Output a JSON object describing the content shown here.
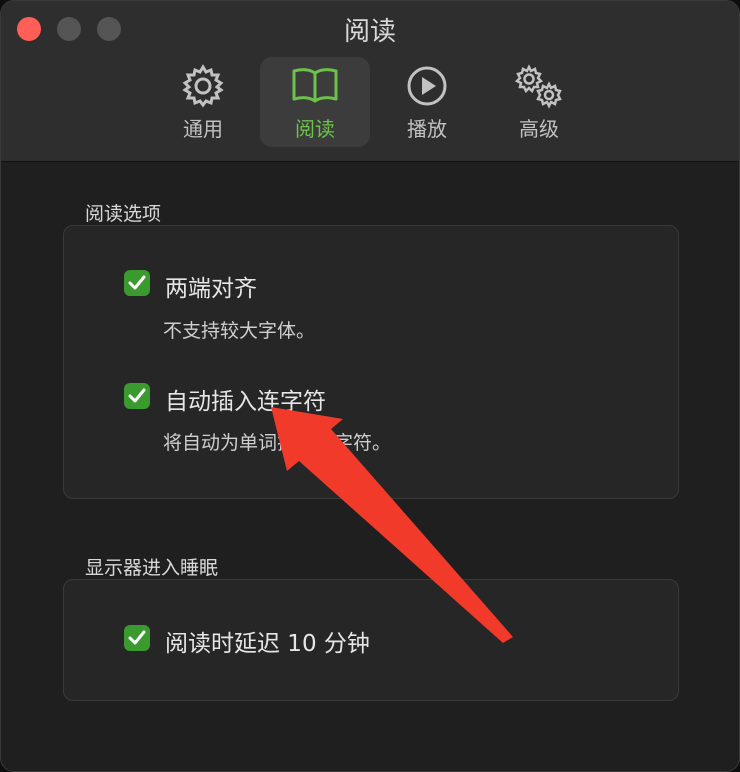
{
  "window": {
    "title": "阅读"
  },
  "toolbar": {
    "items": [
      {
        "label": "通用",
        "icon": "gear-icon"
      },
      {
        "label": "阅读",
        "icon": "book-icon",
        "active": true
      },
      {
        "label": "播放",
        "icon": "play-icon"
      },
      {
        "label": "高级",
        "icon": "gears-icon"
      }
    ]
  },
  "reading_options": {
    "title": "阅读选项",
    "justify": {
      "label": "两端对齐",
      "checked": true,
      "desc": "不支持较大字体。"
    },
    "hyphenate": {
      "label": "自动插入连字符",
      "checked": true,
      "desc": "将自动为单词插入连字符。"
    }
  },
  "display_sleep": {
    "title": "显示器进入睡眠",
    "delay": {
      "label": "阅读时延迟 10 分钟",
      "checked": true
    }
  },
  "colors": {
    "accent": "#6cc24a",
    "checkbox": "#3a9a2e",
    "annotation_arrow": "#f23a2a"
  }
}
